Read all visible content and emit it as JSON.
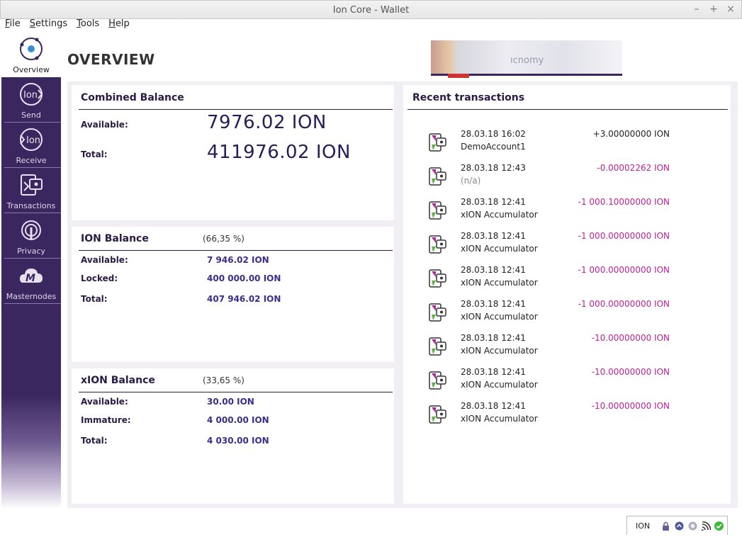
{
  "window": {
    "title": "Ion Core - Wallet",
    "minimize": "–",
    "maximize": "+",
    "close": "×"
  },
  "menu": [
    {
      "key": "F",
      "rest": "ile"
    },
    {
      "key": "S",
      "rest": "ettings"
    },
    {
      "key": "T",
      "rest": "ools"
    },
    {
      "key": "H",
      "rest": "elp"
    }
  ],
  "sidebar": {
    "items": [
      {
        "label": "Overview",
        "icon": "overview-icon",
        "active": true
      },
      {
        "label": "Send",
        "icon": "send-icon"
      },
      {
        "label": "Receive",
        "icon": "receive-icon"
      },
      {
        "label": "Transactions",
        "icon": "transactions-icon"
      },
      {
        "label": "Privacy",
        "icon": "privacy-icon"
      },
      {
        "label": "Masternodes",
        "icon": "masternodes-icon"
      }
    ]
  },
  "page": {
    "title": "OVERVIEW",
    "logo_text": "ıcnomy"
  },
  "combined": {
    "title": "Combined Balance",
    "available_label": "Available:",
    "available_value": "7976.02 ION",
    "total_label": "Total:",
    "total_value": "411976.02 ION"
  },
  "ion": {
    "title": "ION Balance",
    "percent": "(66,35 %)",
    "available_label": "Available:",
    "available_value": "7 946.02 ION",
    "locked_label": "Locked:",
    "locked_value": "400 000.00 ION",
    "total_label": "Total:",
    "total_value": "407 946.02 ION"
  },
  "xion": {
    "title": "xION Balance",
    "percent": "(33,65 %)",
    "available_label": "Available:",
    "available_value": "30.00 ION",
    "immature_label": "Immature:",
    "immature_value": "4 000.00 ION",
    "total_label": "Total:",
    "total_value": "4 030.00 ION"
  },
  "recent": {
    "title": "Recent transactions",
    "transactions": [
      {
        "date": "28.03.18 16:02",
        "address": "DemoAccount1",
        "amount": "+3.00000000 ION",
        "positive": true
      },
      {
        "date": "28.03.18 12:43",
        "address": "(n/a)",
        "amount": "-0.00002262 ION",
        "na": true
      },
      {
        "date": "28.03.18 12:41",
        "address": "xION Accumulator",
        "amount": "-1 000.10000000 ION"
      },
      {
        "date": "28.03.18 12:41",
        "address": "xION Accumulator",
        "amount": "-1 000.00000000 ION"
      },
      {
        "date": "28.03.18 12:41",
        "address": "xION Accumulator",
        "amount": "-1 000.00000000 ION"
      },
      {
        "date": "28.03.18 12:41",
        "address": "xION Accumulator",
        "amount": "-1 000.00000000 ION"
      },
      {
        "date": "28.03.18 12:41",
        "address": "xION Accumulator",
        "amount": "-10.00000000 ION"
      },
      {
        "date": "28.03.18 12:41",
        "address": "xION Accumulator",
        "amount": "-10.00000000 ION"
      },
      {
        "date": "28.03.18 12:41",
        "address": "xION Accumulator",
        "amount": "-10.00000000 ION"
      }
    ]
  },
  "status": {
    "unit": "ION",
    "icons": [
      "lock-icon",
      "staking-icon",
      "zion-icon",
      "network-icon",
      "synced-check-icon"
    ]
  },
  "colors": {
    "brand": "#3b2760",
    "negative": "#c0209a",
    "value": "#3d2c8a"
  }
}
